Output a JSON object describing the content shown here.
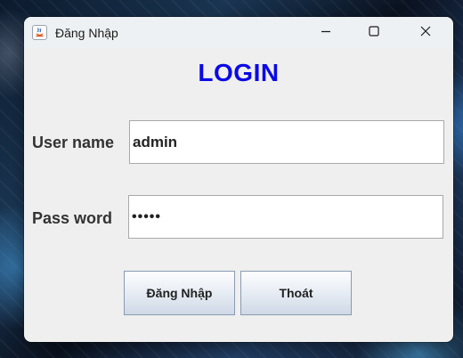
{
  "window": {
    "title": "Đăng Nhập",
    "icon": "java-app-icon",
    "controls": [
      "minimize-icon",
      "maximize-icon",
      "close-icon"
    ]
  },
  "form": {
    "heading": "LOGIN",
    "username_label": "User name",
    "username_value": "admin",
    "password_label": "Pass word",
    "password_masked": "•••••"
  },
  "buttons": {
    "login_label": "Đăng Nhập",
    "exit_label": "Thoát"
  },
  "colors": {
    "heading": "#0a0ae6",
    "window_bg": "#efefef",
    "titlebar_bg": "#eef1f4"
  }
}
